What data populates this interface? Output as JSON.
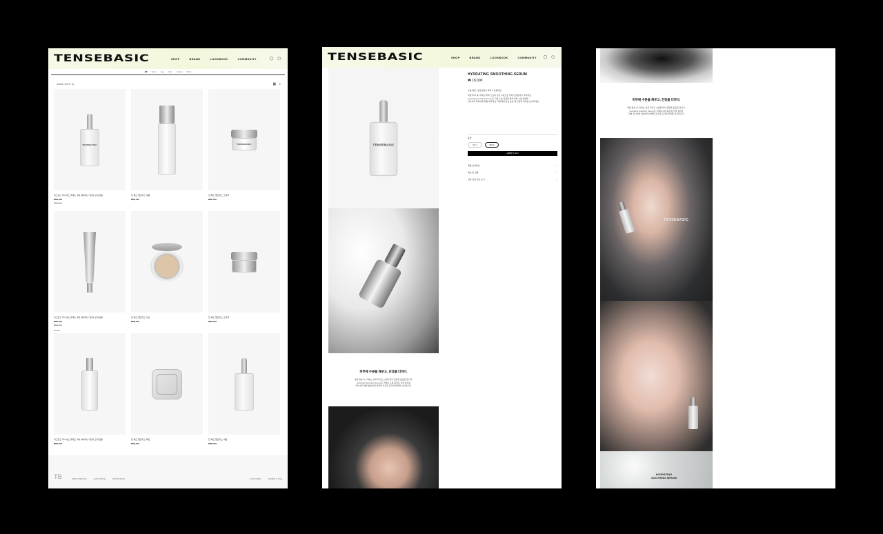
{
  "brand": "TENSEBASIC",
  "nav": [
    "SHOP",
    "BRAND",
    "LOOKBOOK",
    "COMMUNITY"
  ],
  "header_icons": [
    "user-icon",
    "bag-icon"
  ],
  "shop": {
    "subnav": [
      "All",
      "Toner",
      "Eye",
      "Skin",
      "Hands",
      "Body"
    ],
    "sort_label": "ITEMS / 8OFT / 10",
    "side_tag": "NODE",
    "products": [
      {
        "title": "리그란드 러시세스 볼래드 세이 [에어리] 가딘의 오테 립용",
        "price": "₩00,000",
        "old": "₩00,000",
        "shape": "dropper"
      },
      {
        "title": "한 헤드 펠프라스 세럼",
        "price": "₩00,000",
        "old": "",
        "shape": "tall"
      },
      {
        "title": "한 헤드 펠프라스 크리믈",
        "price": "₩00,000",
        "old": "",
        "shape": "jar"
      },
      {
        "title": "리그란드 러시세스 볼래드 세이 [에어리] 가딘의 오테 립용",
        "price": "₩00,000",
        "old": "₩00,000",
        "shape": "tube"
      },
      {
        "title": "한 헤드 펠프라스 쿠션",
        "price": "₩00,000",
        "old": "",
        "shape": "cushion"
      },
      {
        "title": "한 헤드 펠프라스 크리믈",
        "price": "₩00,000",
        "old": "",
        "shape": "jar-silver"
      },
      {
        "title": "리그란드 러시세스 볼래드 세이 [에어리] 가딘의 오테 립용",
        "price": "₩00,000",
        "old": "",
        "shape": "spray"
      },
      {
        "title": "한 헤드 펠프라스 팩트",
        "price": "₩00,000",
        "old": "",
        "shape": "compact"
      },
      {
        "title": "한 헤드 펠프라스 세럼",
        "price": "₩00,000",
        "old": "",
        "shape": "dropper"
      }
    ],
    "footer_links": [
      "ABOUT BRAND",
      "SHOP PAGE",
      "INSTAGRAM",
      "CUSTOMER",
      "TERMS & USE"
    ]
  },
  "product": {
    "name": "HYDRATING SMOOTHING SERUM",
    "price": "₩ 18,000",
    "desc": "수분 충전 | 진정 효과 | 피부 & 트롤개선",
    "lines": [
      "바쁜 피부 속, 피부는 피부 고요의 모든 수분으로 올바 진정효과가 해주세요.",
      "Hydrating Soothing Serum은 기본 수분 공급을 통해 피부 수분 장벽을",
      "건강하게 피부에게 매일 해주세요. 피부에게 필요 보습 쾌 진정과 회복을 보여주세요."
    ],
    "option_label": "용량",
    "options": [
      "30ml",
      "50ml"
    ],
    "selected_option": "50ml",
    "buy_label": "구매하기 BUY",
    "accordion": [
      "제품 상세정보",
      "배송 및 반품",
      "성분 포함 정보 보기"
    ],
    "copy_head": "피부에 수분을 채우고, 진정을 더하다.",
    "copy_lines": [
      "바쁜 일상 속, 피부는 쉽게 지치고 수분을 잃어 진정을 필요로 합니다.",
      "Hydrating Soothing Serum은 가벼운 수분 충전과 진정 효과로",
      "피부 컨디션을 편안하게 되돌려 건강한 윤기와 탄력을 선사합니다."
    ]
  },
  "detail": {
    "copy_head": "피부에 수분을 채우고, 진정을 더하다.",
    "copy_lines": [
      "바쁜 일상 속, 피부는 쉽게 지치고 수분을 잃어 진정을 필요로 합니다.",
      "Hydrating Soothing Serum은 가벼운 수분 충전과 진정 효과로",
      "피부 컨디션을 편안하게 되돌려 건강한 윤기와 탄력을 선사합니다."
    ],
    "brandmark": "TENSEBASIC",
    "serum_heading": [
      "HYDRATING",
      "SOOTHING SERUM"
    ]
  }
}
